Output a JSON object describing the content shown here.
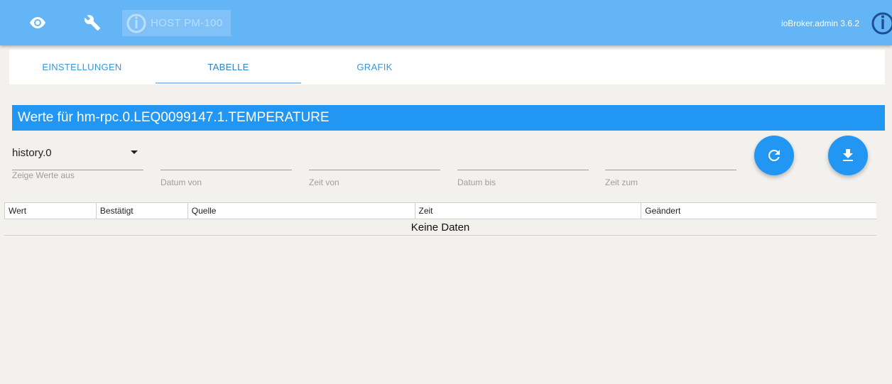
{
  "topbar": {
    "host_label": "HOST PM-100",
    "admin_version": "ioBroker.admin 3.6.2",
    "icons": [
      "eye-icon",
      "wrench-icon",
      "iobroker-logo-icon"
    ]
  },
  "tabs": [
    {
      "label": "EINSTELLUNGEN",
      "active": false
    },
    {
      "label": "TABELLE",
      "active": true
    },
    {
      "label": "GRAFIK",
      "active": false
    }
  ],
  "title": "Werte für hm-rpc.0.LEQ0099147.1.TEMPERATURE",
  "filters": {
    "instance_value": "history.0",
    "instance_label": "Zeige Werte aus",
    "date_from_label": "Datum von",
    "time_from_label": "Zeit von",
    "date_to_label": "Datum bis",
    "time_to_label": "Zeit zum"
  },
  "actions": [
    "refresh-icon",
    "download-icon"
  ],
  "table": {
    "columns": [
      "Wert",
      "Bestätigt",
      "Quelle",
      "Zeit",
      "Geändert"
    ],
    "empty_text": "Keine Daten"
  },
  "colors": {
    "topbar": "#64b5f6",
    "accent": "#2196f3",
    "background": "#f3f1ee"
  }
}
